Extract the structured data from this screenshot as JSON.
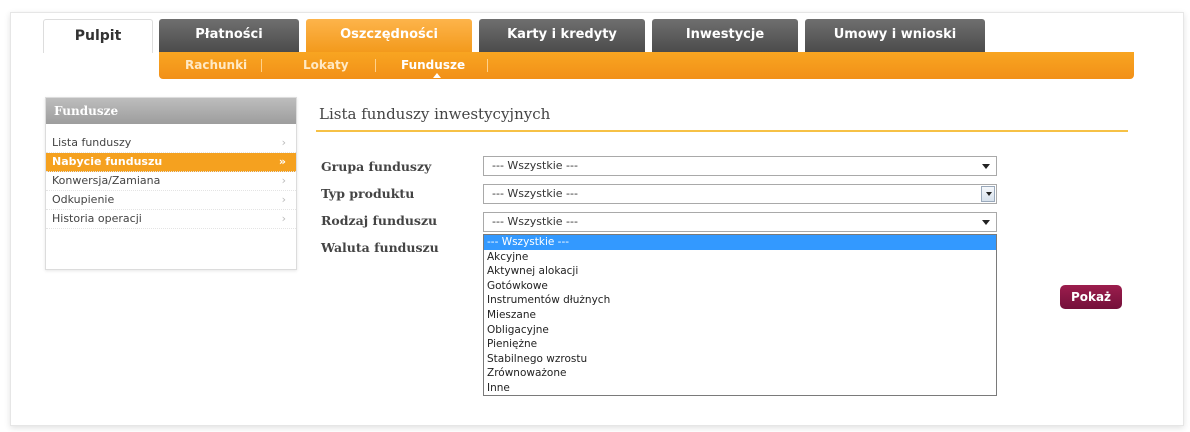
{
  "tabs": [
    {
      "label": "Pulpit"
    },
    {
      "label": "Płatności"
    },
    {
      "label": "Oszczędności"
    },
    {
      "label": "Karty i kredyty"
    },
    {
      "label": "Inwestycje"
    },
    {
      "label": "Umowy i wnioski"
    }
  ],
  "active_tab": "Oszczędności",
  "subnav": {
    "items": [
      {
        "label": "Rachunki"
      },
      {
        "label": "Lokaty"
      },
      {
        "label": "Fundusze"
      }
    ],
    "current": "Fundusze"
  },
  "sidebar": {
    "title": "Fundusze",
    "items": [
      {
        "label": "Lista funduszy",
        "arrow": "›"
      },
      {
        "label": "Nabycie funduszu",
        "arrow": "»"
      },
      {
        "label": "Konwersja/Zamiana",
        "arrow": "›"
      },
      {
        "label": "Odkupienie",
        "arrow": "›"
      },
      {
        "label": "Historia operacji",
        "arrow": "›"
      }
    ],
    "selected": "Nabycie funduszu"
  },
  "main": {
    "title": "Lista funduszy inwestycyjnych",
    "form": {
      "group_label": "Grupa funduszy",
      "group_value": "--- Wszystkie ---",
      "type_label": "Typ produktu",
      "type_value": "--- Wszystkie ---",
      "kind_label": "Rodzaj funduszu",
      "kind_value": "--- Wszystkie ---",
      "currency_label": "Waluta funduszu"
    },
    "kind_options": [
      "--- Wszystkie ---",
      "Akcyjne",
      "Aktywnej alokacji",
      "Gotówkowe",
      "Instrumentów dłużnych",
      "Mieszane",
      "Obligacyjne",
      "Pieniężne",
      "Stabilnego wzrostu",
      "Zrównoważone",
      "Inne"
    ],
    "show_button": "Pokaż"
  },
  "colors": {
    "accent_orange": "#f39a1c",
    "tab_gray": "#555555",
    "button_maroon": "#8a1744",
    "highlight_blue": "#3399ff"
  }
}
